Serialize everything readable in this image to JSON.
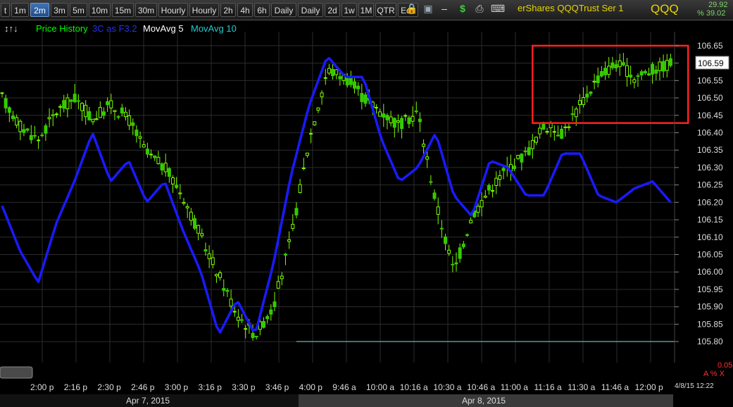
{
  "toolbar": {
    "tabs": [
      {
        "label": "t",
        "w": 13
      },
      {
        "label": "1m",
        "w": 25
      },
      {
        "label": "2m",
        "w": 27,
        "active": true
      },
      {
        "label": "3m",
        "w": 25
      },
      {
        "label": "5m",
        "w": 25
      },
      {
        "label": "10m",
        "w": 31
      },
      {
        "label": "15m",
        "w": 31
      },
      {
        "label": "30m",
        "w": 31
      },
      {
        "label": "Hourly",
        "w": 42
      },
      {
        "label": "Hourly",
        "w": 42
      },
      {
        "label": "2h",
        "w": 22
      },
      {
        "label": "4h",
        "w": 22
      },
      {
        "label": "6h",
        "w": 22
      },
      {
        "label": "Daily",
        "w": 36
      },
      {
        "label": "Daily",
        "w": 36
      },
      {
        "label": "2d",
        "w": 22
      },
      {
        "label": "1w",
        "w": 22
      },
      {
        "label": "1M",
        "w": 22
      },
      {
        "label": "QTR",
        "w": 30
      },
      {
        "label": "Edit",
        "w": 29
      }
    ],
    "icons": [
      "lock-icon",
      "save-icon",
      "dollar-icon",
      "print-icon",
      "keyboard-icon",
      "minus-icon"
    ],
    "security_name": "erShares QQQTrust Ser 1",
    "symbol": "QQQ",
    "top_value_1": "29.92",
    "top_value_2": "% 39.02"
  },
  "legend": {
    "arrows": "↕↑↓",
    "price_history": "Price History",
    "indicator": "3C as F3.2",
    "ma5": "MovAvg 5",
    "ma10": "MovAvg 10"
  },
  "colors": {
    "up": "#80ff00",
    "down": "#33cc00",
    "indicator": "#1a1aff",
    "highlight_box": "#ff2020",
    "support_line": "#5fa3a3",
    "legend_price": "#00ff00",
    "legend_indicator": "#2233ee",
    "legend_ma5": "#ffffff",
    "legend_ma10": "#22cccc"
  },
  "chart_data": {
    "type": "candlestick",
    "ylim": [
      105.78,
      106.67
    ],
    "y_ticks": [
      "106.65",
      "106.60",
      "106.55",
      "106.50",
      "106.45",
      "106.40",
      "106.35",
      "106.30",
      "106.25",
      "106.20",
      "106.15",
      "106.10",
      "106.05",
      "106.00",
      "105.95",
      "105.90",
      "105.85",
      "105.80"
    ],
    "last_price": "106.59",
    "x_labels": [
      "2:00 p",
      "2:16 p",
      "2:30 p",
      "2:46 p",
      "3:00 p",
      "3:16 p",
      "3:30 p",
      "3:46 p",
      "4:00 p",
      "9:46 a",
      "10:00 a",
      "10:16 a",
      "10:30 a",
      "10:46 a",
      "11:00 a",
      "11:16 a",
      "11:30 a",
      "11:46 a",
      "12:00 p"
    ],
    "dates": [
      "Apr 7, 2015",
      "Apr 8, 2015"
    ],
    "timestamp": "4/8/15 12:22",
    "scale_value": "0.05",
    "scale_label": "A % X",
    "price_anchors": [
      106.5,
      106.42,
      106.38,
      106.46,
      106.5,
      106.44,
      106.48,
      106.44,
      106.34,
      106.3,
      106.22,
      106.1,
      105.99,
      105.88,
      105.82,
      105.9,
      106.1,
      106.38,
      106.58,
      106.56,
      106.5,
      106.46,
      106.42,
      106.46,
      106.2,
      106.0,
      106.16,
      106.24,
      106.3,
      106.34,
      106.42,
      106.4,
      106.48,
      106.56,
      106.6,
      106.56,
      106.58,
      106.6
    ],
    "indicator_anchors": [
      106.19,
      106.06,
      105.97,
      106.14,
      106.26,
      106.4,
      106.26,
      106.32,
      106.2,
      106.26,
      106.12,
      106.0,
      105.82,
      105.92,
      105.82,
      106.02,
      106.28,
      106.48,
      106.62,
      106.56,
      106.56,
      106.38,
      106.26,
      106.3,
      106.4,
      106.22,
      106.16,
      106.32,
      106.3,
      106.22,
      106.22,
      106.34,
      106.34,
      106.22,
      106.2,
      106.24,
      106.26,
      106.2
    ],
    "highlight_box": {
      "from_index": 146,
      "to_index": 183,
      "y_top": 106.65,
      "y_bottom": 106.44
    },
    "support_level": 105.8
  }
}
